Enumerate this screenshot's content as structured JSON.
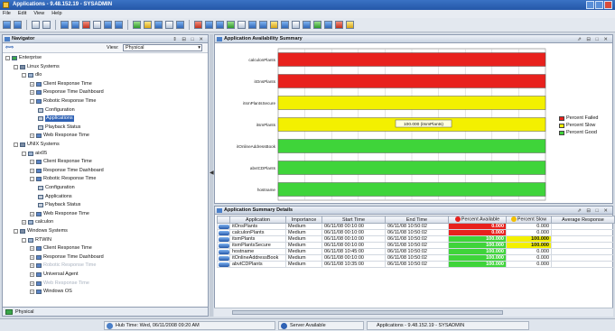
{
  "window": {
    "title": "Applications - 9.48.152.19 - SYSADMIN"
  },
  "menu": [
    "File",
    "Edit",
    "View",
    "Help"
  ],
  "navigator": {
    "title": "Navigator",
    "view_label": "View:",
    "view_value": "Physical",
    "footer_tab": "Physical",
    "tree": [
      {
        "label": "Enterprise",
        "depth": 0,
        "icon": "root",
        "exp": "-"
      },
      {
        "label": "Linux Systems",
        "depth": 1,
        "icon": "sys",
        "exp": "-"
      },
      {
        "label": "dlo",
        "depth": 2,
        "icon": "host",
        "exp": "-"
      },
      {
        "label": "Client Response Time",
        "depth": 3,
        "icon": "app",
        "exp": "+"
      },
      {
        "label": "Response Time Dashboard",
        "depth": 3,
        "icon": "app",
        "exp": "+"
      },
      {
        "label": "Robotic Response Time",
        "depth": 3,
        "icon": "app",
        "exp": "-"
      },
      {
        "label": "Configuration",
        "depth": 4,
        "icon": "cfg",
        "exp": ""
      },
      {
        "label": "Applications",
        "depth": 4,
        "icon": "cfg",
        "exp": "",
        "selected": true
      },
      {
        "label": "Playback Status",
        "depth": 4,
        "icon": "cfg",
        "exp": ""
      },
      {
        "label": "Web Response Time",
        "depth": 3,
        "icon": "app",
        "exp": "+"
      },
      {
        "label": "UNIX Systems",
        "depth": 1,
        "icon": "sys",
        "exp": "-"
      },
      {
        "label": "aix05",
        "depth": 2,
        "icon": "host",
        "exp": "-"
      },
      {
        "label": "Client Response Time",
        "depth": 3,
        "icon": "app",
        "exp": "+"
      },
      {
        "label": "Response Time Dashboard",
        "depth": 3,
        "icon": "app",
        "exp": "+"
      },
      {
        "label": "Robotic Response Time",
        "depth": 3,
        "icon": "app",
        "exp": "-"
      },
      {
        "label": "Configuration",
        "depth": 4,
        "icon": "cfg",
        "exp": ""
      },
      {
        "label": "Applications",
        "depth": 4,
        "icon": "cfg",
        "exp": ""
      },
      {
        "label": "Playback Status",
        "depth": 4,
        "icon": "cfg",
        "exp": ""
      },
      {
        "label": "Web Response Time",
        "depth": 3,
        "icon": "app",
        "exp": "+"
      },
      {
        "label": "calculon",
        "depth": 2,
        "icon": "host",
        "exp": "+"
      },
      {
        "label": "Windows Systems",
        "depth": 1,
        "icon": "sys",
        "exp": "-"
      },
      {
        "label": "RTWIN",
        "depth": 2,
        "icon": "host",
        "exp": "-"
      },
      {
        "label": "Client Response Time",
        "depth": 3,
        "icon": "app",
        "exp": "+"
      },
      {
        "label": "Response Time Dashboard",
        "depth": 3,
        "icon": "app",
        "exp": "+"
      },
      {
        "label": "Robotic Response Time",
        "depth": 3,
        "icon": "app",
        "exp": "+",
        "dim": true
      },
      {
        "label": "Universal Agent",
        "depth": 3,
        "icon": "app",
        "exp": "+"
      },
      {
        "label": "Web Response Time",
        "depth": 3,
        "icon": "app",
        "exp": "+",
        "dim": true
      },
      {
        "label": "Windows OS",
        "depth": 3,
        "icon": "app",
        "exp": "+"
      }
    ]
  },
  "chart_panel": {
    "title": "Application Availability Summary",
    "tooltip": "100.000 (itsmPlants)"
  },
  "chart_data": {
    "type": "bar",
    "orientation": "horizontal",
    "stacked": true,
    "categories": [
      "calculonPlants",
      "itOnsPlants",
      "itsmPlantsSecure",
      "itsmPlants",
      "itOnlineAddressBook",
      "abvtCDPlants",
      "hostname"
    ],
    "series": [
      {
        "name": "Percent Failed",
        "color": "#e8211d",
        "values": [
          100,
          100,
          0,
          0,
          0,
          0,
          0
        ]
      },
      {
        "name": "Percent Slow",
        "color": "#f3f000",
        "values": [
          0,
          0,
          100,
          100,
          0,
          0,
          0
        ]
      },
      {
        "name": "Percent Good",
        "color": "#3fd43a",
        "values": [
          0,
          0,
          0,
          0,
          100,
          100,
          100
        ]
      }
    ],
    "xlim": [
      0,
      100
    ],
    "xticks": [
      0,
      10,
      20,
      30,
      40,
      50,
      60,
      70,
      80,
      90,
      100
    ],
    "grid": true,
    "legend": "right"
  },
  "grid_panel": {
    "title": "Application Summary Details",
    "columns": [
      "",
      "Application",
      "Importance",
      "Start Time",
      "End Time",
      "Percent Available",
      "Percent Slow",
      "Average Response"
    ],
    "rows": [
      [
        "",
        "itOnsPlants",
        "Medium",
        "06/11/08 00:10:00",
        "06/11/08 10:50:02",
        "0.000",
        "0.000",
        ""
      ],
      [
        "",
        "calculonPlants",
        "Medium",
        "06/11/08 00:10:00",
        "06/11/08 10:50:02",
        "0.000",
        "0.000",
        ""
      ],
      [
        "",
        "itsmPlants",
        "Medium",
        "06/11/08 00:10:00",
        "06/11/08 10:50:02",
        "100.000",
        "100.000",
        ""
      ],
      [
        "",
        "itsmPlantsSecure",
        "Medium",
        "06/11/08 00:10:00",
        "06/11/08 10:50:02",
        "100.000",
        "100.000",
        ""
      ],
      [
        "",
        "hostname",
        "Medium",
        "06/11/08 10:45:00",
        "06/11/08 10:50:02",
        "100.000",
        "0.000",
        ""
      ],
      [
        "",
        "itOnlineAddressBook",
        "Medium",
        "06/11/08 00:10:00",
        "06/11/08 10:50:02",
        "100.000",
        "0.000",
        ""
      ],
      [
        "",
        "abvtCDPlants",
        "Medium",
        "06/11/08 10:35:00",
        "06/11/08 10:50:02",
        "100.000",
        "0.000",
        ""
      ]
    ],
    "avail_colors": [
      "#e8211d",
      "#e8211d",
      "#3fd43a",
      "#3fd43a",
      "#3fd43a",
      "#3fd43a",
      "#3fd43a"
    ],
    "slow_colors": [
      "",
      "",
      "#f3f000",
      "#f3f000",
      "",
      "",
      ""
    ]
  },
  "status": {
    "hub_time": "Hub Time: Wed, 06/11/2008 09:20 AM",
    "server": "Server Available",
    "session": "Applications - 9.48.152.19 - SYSADMIN"
  }
}
